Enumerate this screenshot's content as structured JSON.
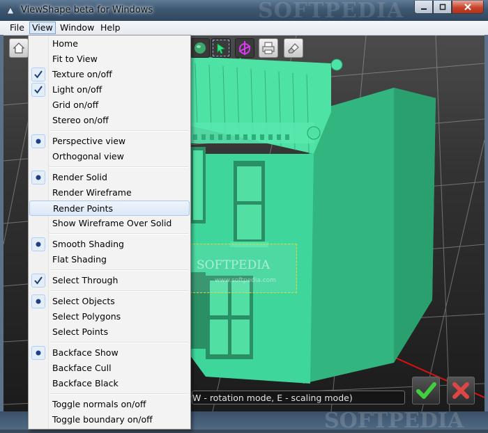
{
  "window": {
    "title": "ViewShape beta for Windows",
    "watermark": "SOFTPEDIA",
    "controls": [
      "minimize",
      "maximize",
      "close"
    ]
  },
  "menubar": {
    "items": [
      {
        "label": "File"
      },
      {
        "label": "View",
        "active": true
      },
      {
        "label": "Window"
      },
      {
        "label": "Help"
      }
    ]
  },
  "view_menu": {
    "groups": [
      [
        {
          "label": "Home",
          "mark": "none"
        },
        {
          "label": "Fit to View",
          "mark": "none"
        },
        {
          "label": "Texture on/off",
          "mark": "check"
        },
        {
          "label": "Light on/off",
          "mark": "check"
        },
        {
          "label": "Grid on/off",
          "mark": "none"
        },
        {
          "label": "Stereo on/off",
          "mark": "none"
        }
      ],
      [
        {
          "label": "Perspective view",
          "mark": "radio"
        },
        {
          "label": "Orthogonal view",
          "mark": "none"
        }
      ],
      [
        {
          "label": "Render Solid",
          "mark": "radio"
        },
        {
          "label": "Render Wireframe",
          "mark": "none"
        },
        {
          "label": "Render Points",
          "mark": "none",
          "highlighted": true
        },
        {
          "label": "Show Wireframe Over Solid",
          "mark": "none"
        }
      ],
      [
        {
          "label": "Smooth Shading",
          "mark": "radio"
        },
        {
          "label": "Flat Shading",
          "mark": "none"
        }
      ],
      [
        {
          "label": "Select Through",
          "mark": "check"
        }
      ],
      [
        {
          "label": "Select Objects",
          "mark": "radio"
        },
        {
          "label": "Select Polygons",
          "mark": "none"
        },
        {
          "label": "Select Points",
          "mark": "none"
        }
      ],
      [
        {
          "label": "Backface Show",
          "mark": "radio"
        },
        {
          "label": "Backface Cull",
          "mark": "none"
        },
        {
          "label": "Backface Black",
          "mark": "none"
        }
      ],
      [
        {
          "label": "Toggle normals on/off",
          "mark": "none"
        },
        {
          "label": "Toggle boundary on/off",
          "mark": "none"
        }
      ]
    ]
  },
  "toolbar": {
    "buttons": [
      {
        "icon": "home-icon"
      },
      {
        "icon": "sphere-icon"
      },
      {
        "icon": "select-arrow-icon"
      },
      {
        "icon": "transform-gizmo-icon"
      },
      {
        "icon": "printer-icon"
      },
      {
        "icon": "eraser-icon"
      }
    ]
  },
  "viewport": {
    "status_text": "W - rotation mode, E - scaling mode)",
    "ok_icon": "checkmark-icon",
    "cancel_icon": "x-icon",
    "watermark_main": "SOFTPEDIA",
    "watermark_url": "www.softpedia.com",
    "model_color": "#3ed69a"
  }
}
